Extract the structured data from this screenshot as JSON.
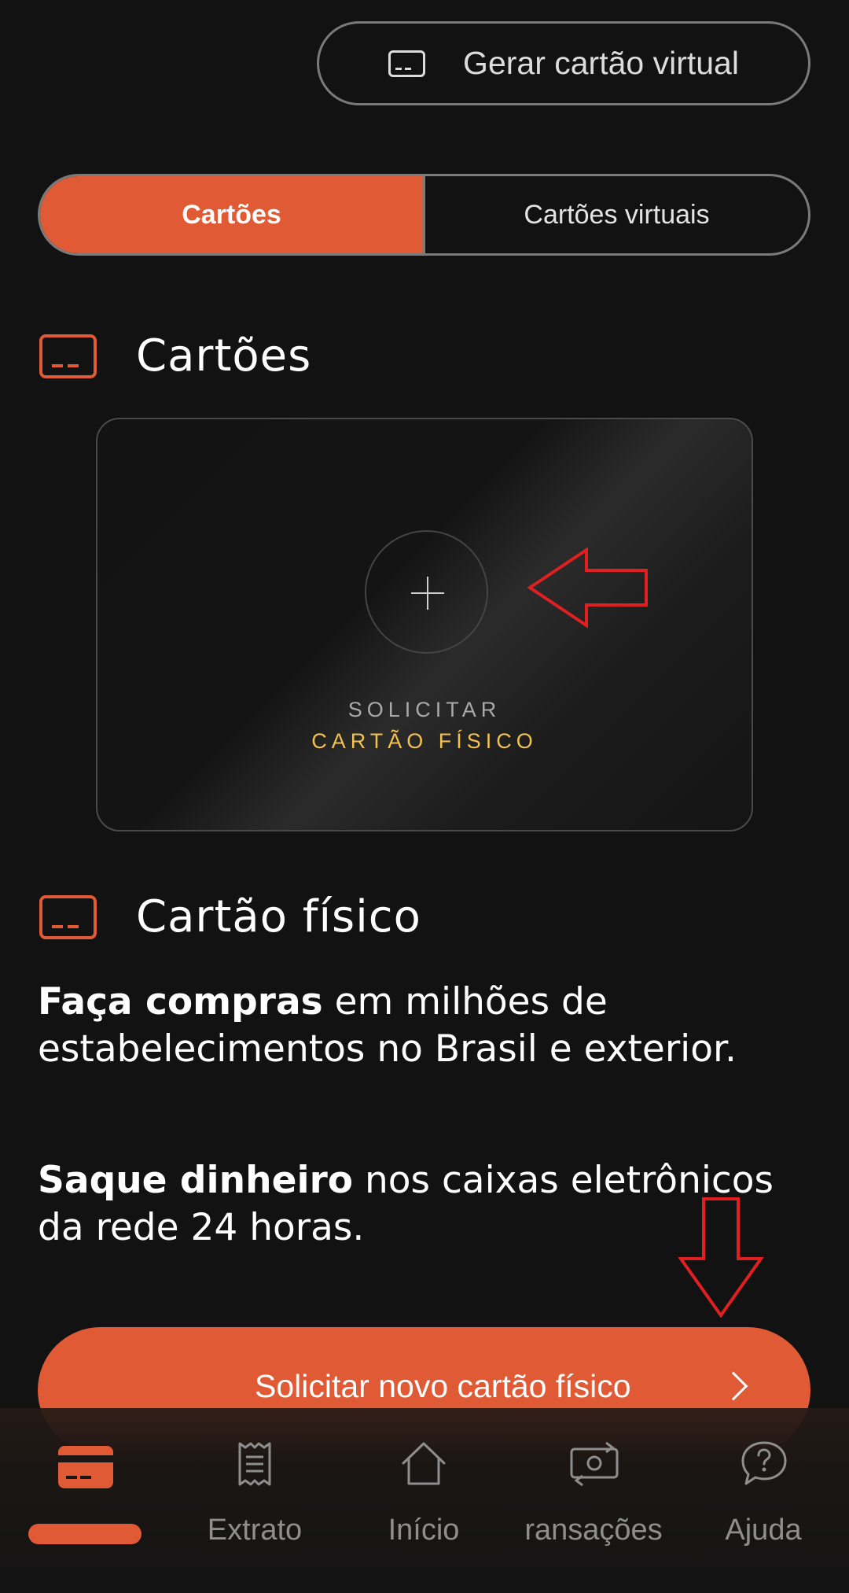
{
  "top_button": {
    "label": "Gerar cartão virtual",
    "icon": "card-icon"
  },
  "segmented": {
    "active": "Cartões",
    "inactive": "Cartões virtuais"
  },
  "section_cards": {
    "title": "Cartões",
    "icon": "card-icon"
  },
  "card_panel": {
    "line1": "SOLICITAR",
    "line2": "CARTÃO FÍSICO",
    "icon": "plus-icon"
  },
  "section_physical": {
    "title": "Cartão físico",
    "icon": "card-icon"
  },
  "paragraph1": {
    "bold": "Faça compras",
    "rest": " em milhões de estabelecimentos no Brasil e exterior."
  },
  "paragraph2": {
    "bold": "Saque dinheiro",
    "rest": " nos caixas eletrônicos da rede 24 horas."
  },
  "cta": {
    "label": "Solicitar novo cartão físico",
    "icon": "chevron-right-icon"
  },
  "bottom_nav": {
    "items": [
      {
        "label": "",
        "icon": "card-icon",
        "active": true
      },
      {
        "label": "Extrato",
        "icon": "receipt-icon"
      },
      {
        "label": "Início",
        "icon": "home-icon"
      },
      {
        "label": "ransações",
        "icon": "money-transfer-icon"
      },
      {
        "label": "Ajuda",
        "icon": "help-icon"
      }
    ]
  },
  "colors": {
    "accent": "#e05a36",
    "background": "#121212",
    "gold": "#f2c14e",
    "annotation": "#e02020"
  }
}
